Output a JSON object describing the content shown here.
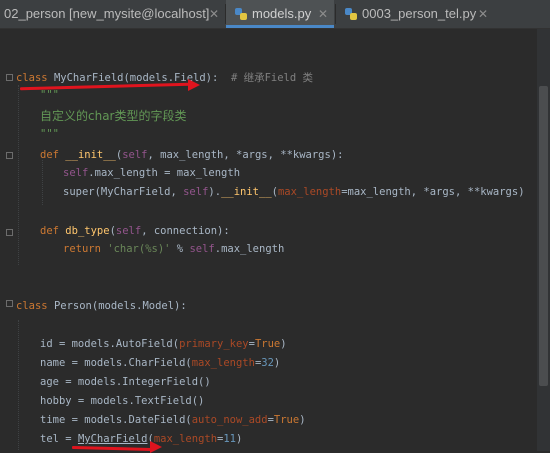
{
  "tabs": [
    {
      "label": "02_person [new_mysite@localhost]",
      "active": false
    },
    {
      "label": "models.py",
      "active": true
    },
    {
      "label": "0003_person_tel.py",
      "active": false
    }
  ],
  "code": {
    "l1": {
      "kw": "class ",
      "name": "MyCharField",
      "args": "(models.Field):  ",
      "comment": "# 继承Field 类"
    },
    "l2": {
      "doc": "\"\"\""
    },
    "l3": {
      "doc": "自定义的char类型的字段类"
    },
    "l4": {
      "doc": "\"\"\""
    },
    "l5": {
      "kw": "def ",
      "name": "__init__",
      "p1": "(",
      "self": "self",
      "rest": ", max_length, *args, **kwargs):"
    },
    "l6": {
      "self": "self",
      "rest": ".max_length = max_length"
    },
    "l7": {
      "a": "super(MyCharField, ",
      "self": "self",
      "b": ").",
      "name": "__init__",
      "c": "(",
      "param": "max_length",
      "d": "=max_length, *args, **kwargs)"
    },
    "l8": {
      "kw": "def ",
      "name": "db_type",
      "p1": "(",
      "self": "self",
      "rest": ", connection):"
    },
    "l9": {
      "kw": "return ",
      "str": "'char(%s)'",
      "a": " % ",
      "self": "self",
      "b": ".max_length"
    },
    "l10": {
      "kw": "class ",
      "rest": "Person(models.Model):"
    },
    "l11": {
      "a": "id = models.AutoField(",
      "param": "primary_key",
      "b": "=",
      "kw": "True",
      "c": ")"
    },
    "l12": {
      "a": "name = models.CharField(",
      "param": "max_length",
      "b": "=",
      "num": "32",
      "c": ")"
    },
    "l13": {
      "a": "age = models.IntegerField()"
    },
    "l14": {
      "a": "hobby = models.TextField()"
    },
    "l15": {
      "a": "time = models.DateField(",
      "param": "auto_now_add",
      "b": "=",
      "kw": "True",
      "c": ")"
    },
    "l16": {
      "a": "tel = ",
      "name": "MyCharField",
      "b": "(",
      "param": "max_length",
      "c": "=",
      "num": "11",
      "d": ")"
    }
  }
}
